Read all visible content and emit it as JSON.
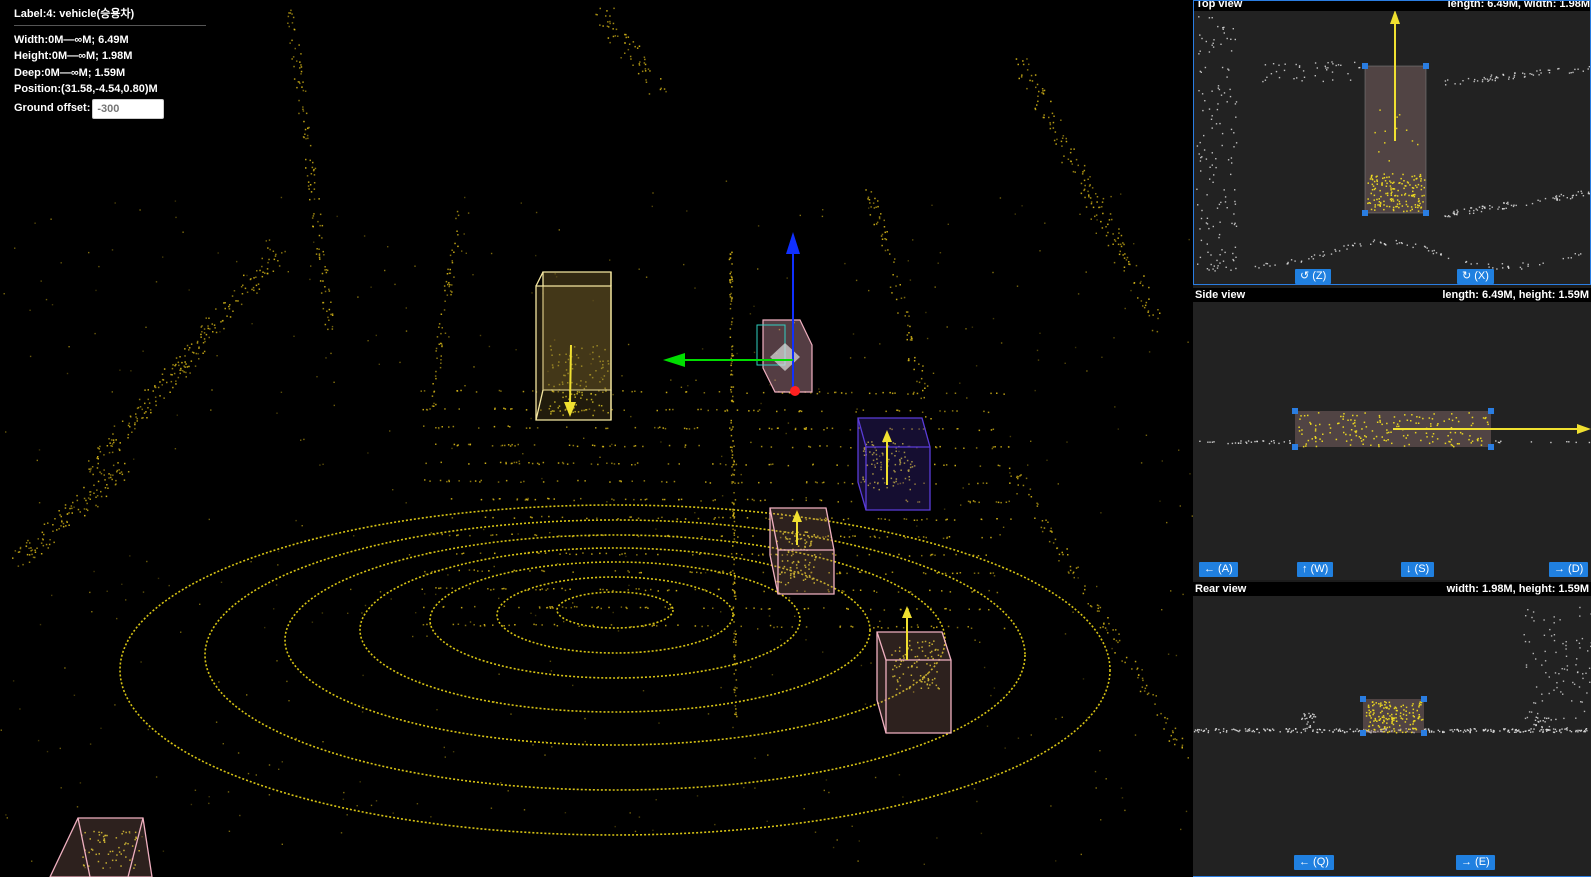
{
  "info": {
    "label": "Label:4: vehicle(승용차)",
    "width": "Width:0M—∞M; 6.49M",
    "height": "Height:0M—∞M; 1.98M",
    "deep": "Deep:0M—∞M; 1.59M",
    "position": "Position:(31.58,-4.54,0.80)M",
    "ground_offset_label": "Ground offset:",
    "ground_offset_value": "-300"
  },
  "views": {
    "top": {
      "title": "Top view",
      "dims": "length: 6.49M, width: 1.98M",
      "buttons": {
        "rotate_ccw": "↺ (Z)",
        "rotate_cw": "↻ (X)"
      }
    },
    "side": {
      "title": "Side view",
      "dims": "length: 6.49M, height: 1.59M",
      "buttons": {
        "left": "← (A)",
        "up": "↑ (W)",
        "down": "↓ (S)",
        "right": "→ (D)"
      }
    },
    "rear": {
      "title": "Rear view",
      "dims": "width: 1.98M, height: 1.59M",
      "buttons": {
        "left": "← (Q)",
        "right": "→ (E)"
      }
    }
  },
  "colors": {
    "points": "#e8d21a",
    "selected_box": "#f0b0c0",
    "active_box": "#ffe9a0",
    "purple_box": "#5a3cd8",
    "axis_x": "#00dd00",
    "axis_y": "#1030ff",
    "axis_origin": "#ff2020",
    "handle": "#2a7de1"
  },
  "icons": {
    "rotate_ccw": "rotate-ccw-icon",
    "rotate_cw": "rotate-cw-icon"
  }
}
